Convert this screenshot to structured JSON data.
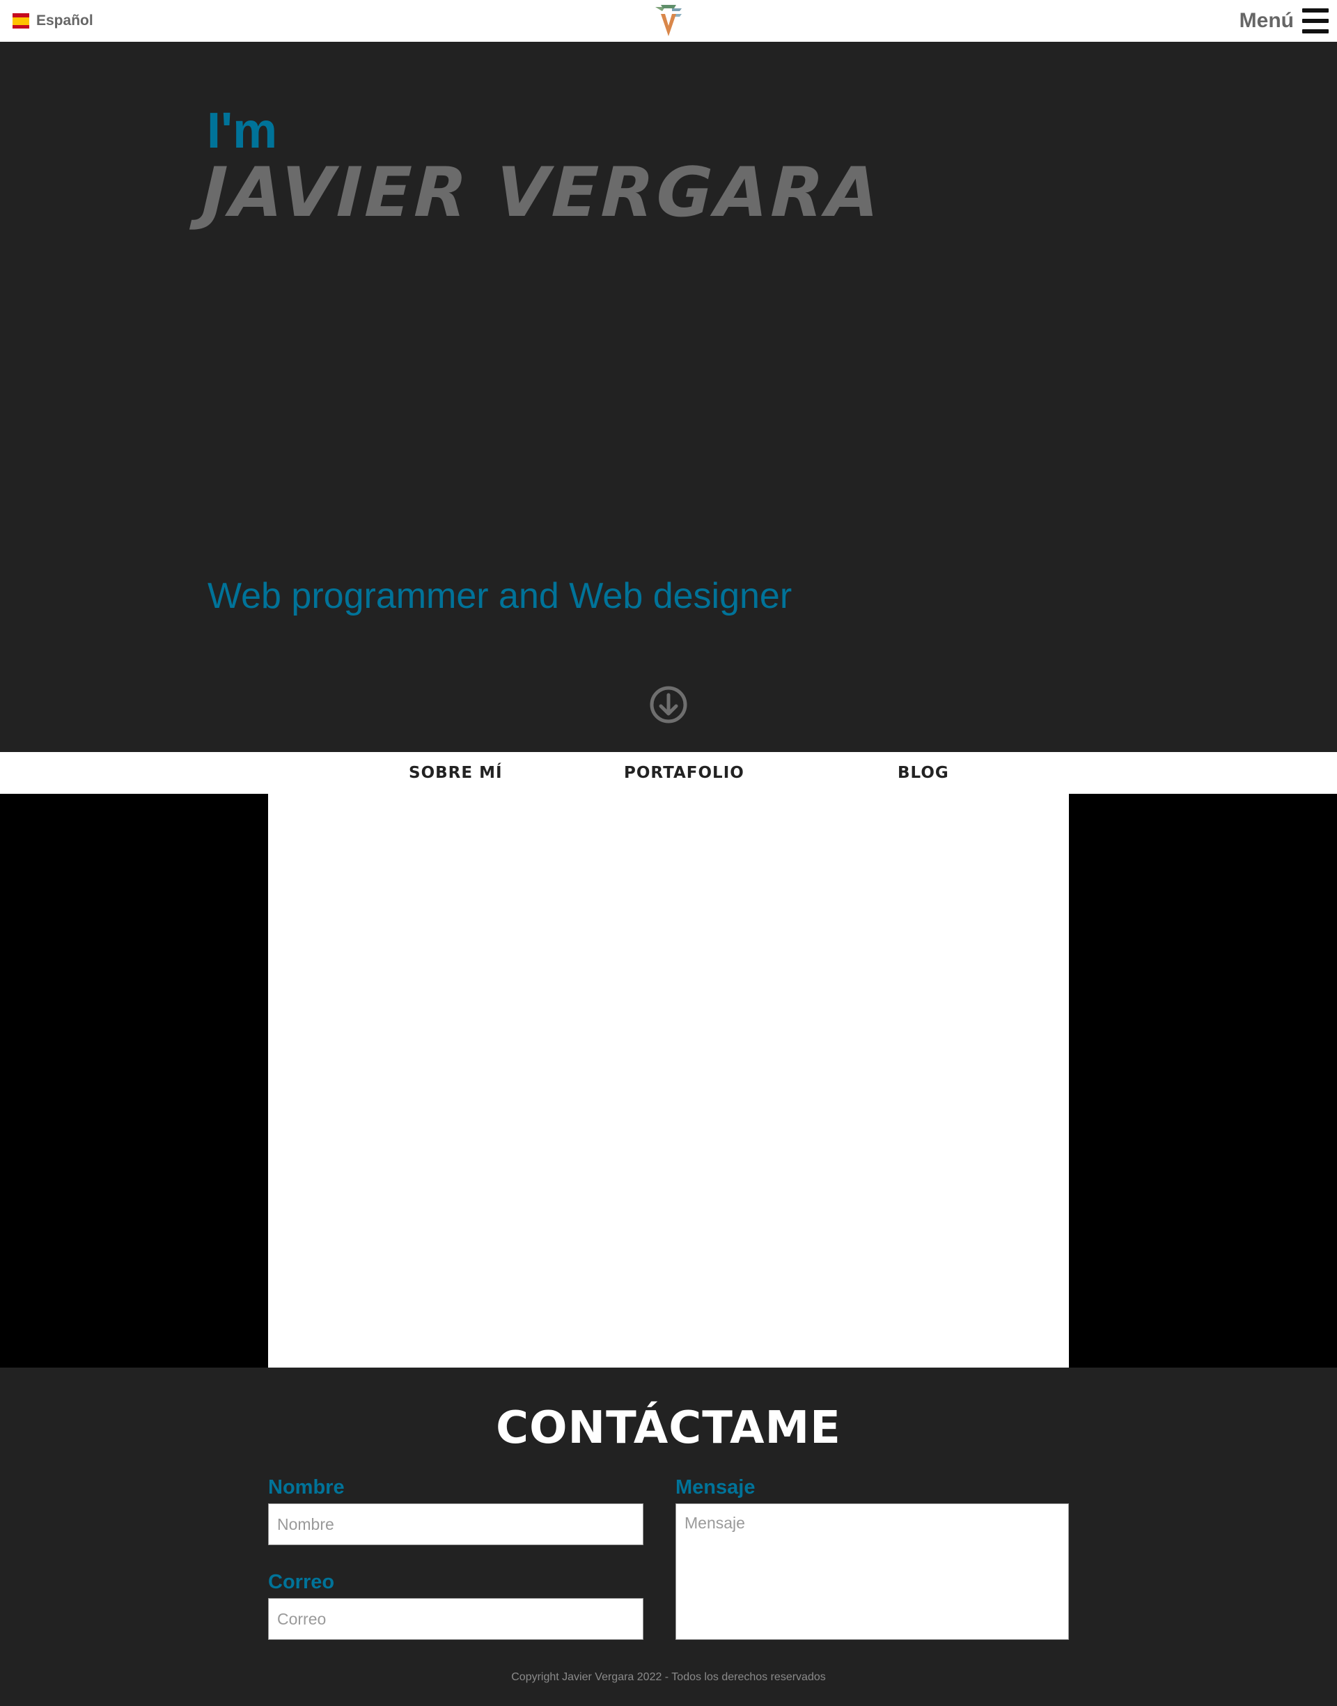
{
  "header": {
    "language_label": "Español",
    "menu_label": "Menú"
  },
  "hero": {
    "intro": "I'm",
    "name": "JAVIER VERGARA",
    "subtitle": "Web programmer and Web designer"
  },
  "section_nav": {
    "items": [
      "SOBRE MÍ",
      "PORTAFOLIO",
      "BLOG"
    ]
  },
  "contact": {
    "title": "CONTÁCTAME",
    "name_label": "Nombre",
    "name_placeholder": "Nombre",
    "email_label": "Correo",
    "email_placeholder": "Correo",
    "message_label": "Mensaje",
    "message_placeholder": "Mensaje"
  },
  "footer": {
    "copyright": "Copyright Javier Vergara 2022 - Todos los derechos reservados"
  },
  "icons": {
    "flag": "spain-flag-icon",
    "logo": "site-logo",
    "menu": "hamburger-icon",
    "scroll": "arrow-down-circle-icon"
  },
  "colors": {
    "accent": "#007399",
    "dark_bg": "#222222",
    "name_gray": "#6b6b6b"
  }
}
